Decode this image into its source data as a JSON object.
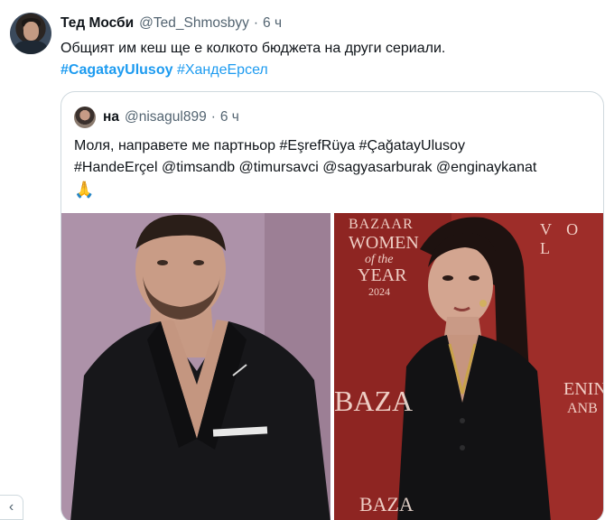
{
  "tweet": {
    "author_name": "Тед Мосби",
    "handle": "@Ted_Shmosbyy",
    "separator": "·",
    "time": "6 ч",
    "text": "Общият им кеш ще е колкото бюджета на други сериали.",
    "hashtags": [
      "#CagatayUlusoy",
      "#ХандеЕрсел"
    ]
  },
  "quote": {
    "author_name": "на",
    "handle": "@nisagul899",
    "separator": "·",
    "time": "6 ч",
    "line1": "Моля, направете ме партньор #EşrefRüya #ÇağatayUlusoy",
    "line2": "#HandeErçel @timsandb @timursavci @sagyasarburak @enginaykanat",
    "emoji": "🙏"
  },
  "images": {
    "right_backdrop_texts": [
      "BAZAAR",
      "WOMEN",
      "of the",
      "YEAR",
      "2024",
      "V O L",
      "BAZA",
      "ENIN",
      "ANB",
      "BAZA"
    ]
  },
  "scroll_button": {
    "icon": "chevron-left-icon",
    "label": "‹"
  },
  "colors": {
    "link": "#1d9bf0",
    "muted": "#536471",
    "border": "#cfd9de"
  }
}
